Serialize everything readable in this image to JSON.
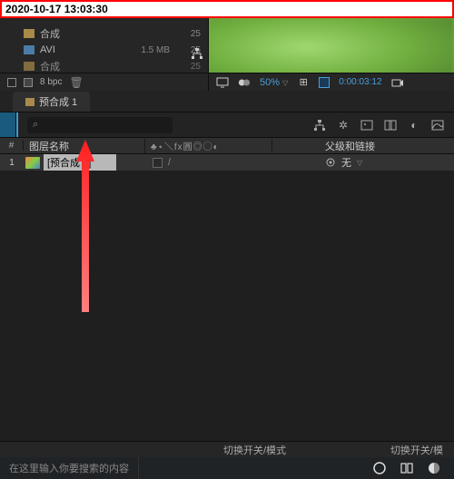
{
  "timestamp": "2020-10-17 13:03:30",
  "project": {
    "items": [
      {
        "type": "folder",
        "name": "合成",
        "num": "25"
      },
      {
        "type": "avi",
        "name": "AVI",
        "size": "1.5 MB",
        "num": "25"
      },
      {
        "type": "folder",
        "name": "合成",
        "num": "25"
      }
    ],
    "bpc": "8 bpc"
  },
  "preview": {
    "zoom": "50%",
    "timecode": "0:00:03:12"
  },
  "timeline": {
    "tab": "预合成 1",
    "columns": {
      "index": "#",
      "layer_name": "图层名称",
      "switches": "♣⋆＼fx圓◎◯◐",
      "parent": "父级和链接"
    },
    "layer": {
      "index": "1",
      "name": "[预合成 1]",
      "parent": "无"
    },
    "toggle_switches_mode": "切换开关/模式",
    "toggle_switches_mode_right": "切换开关/模"
  },
  "taskbar": {
    "search_placeholder": "在这里输入你要搜索的内容"
  }
}
